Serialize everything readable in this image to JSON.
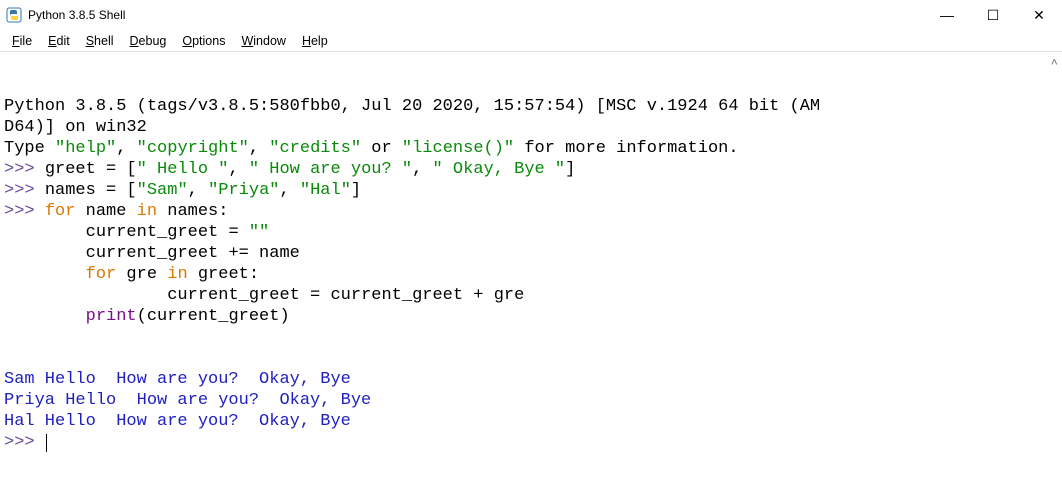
{
  "window": {
    "title": "Python 3.8.5 Shell",
    "controls": {
      "minimize": "—",
      "maximize": "☐",
      "close": "✕"
    }
  },
  "menubar": [
    {
      "key": "F",
      "label": "ile"
    },
    {
      "key": "E",
      "label": "dit"
    },
    {
      "key": "S",
      "label": "hell"
    },
    {
      "key": "D",
      "label": "ebug"
    },
    {
      "key": "O",
      "label": "ptions"
    },
    {
      "key": "W",
      "label": "indow"
    },
    {
      "key": "H",
      "label": "elp"
    }
  ],
  "shell": {
    "banner1": "Python 3.8.5 (tags/v3.8.5:580fbb0, Jul 20 2020, 15:57:54) [MSC v.1924 64 bit (AM",
    "banner2": "D64)] on win32",
    "helpline_a": "Type ",
    "helpline_b": "\"help\"",
    "helpline_c": ", ",
    "helpline_d": "\"copyright\"",
    "helpline_e": ", ",
    "helpline_f": "\"credits\"",
    "helpline_g": " or ",
    "helpline_h": "\"license()\"",
    "helpline_i": " for more information.",
    "prompt": ">>> ",
    "l1_a": "greet = [",
    "l1_s1": "\" Hello \"",
    "l1_c1": ", ",
    "l1_s2": "\" How are you? \"",
    "l1_c2": ", ",
    "l1_s3": "\" Okay, Bye \"",
    "l1_e": "]",
    "l2_a": "names = [",
    "l2_s1": "\"Sam\"",
    "l2_c1": ", ",
    "l2_s2": "\"Priya\"",
    "l2_c2": ", ",
    "l2_s3": "\"Hal\"",
    "l2_e": "]",
    "l3_kw": "for",
    "l3_a": " name ",
    "l3_kw2": "in",
    "l3_b": " names:",
    "l4_pad": "        ",
    "l4_a": "current_greet = ",
    "l4_s": "\"\"",
    "l5_a": "current_greet += name",
    "l6_kw": "for",
    "l6_a": " gre ",
    "l6_kw2": "in",
    "l6_b": " greet:",
    "l7_pad": "                ",
    "l7_a": "current_greet = current_greet + gre",
    "l8_fn": "print",
    "l8_a": "(current_greet)",
    "blank": " ",
    "out1": "Sam Hello  How are you?  Okay, Bye ",
    "out2": "Priya Hello  How are you?  Okay, Bye ",
    "out3": "Hal Hello  How are you?  Okay, Bye ",
    "scroll_ind": "^"
  }
}
